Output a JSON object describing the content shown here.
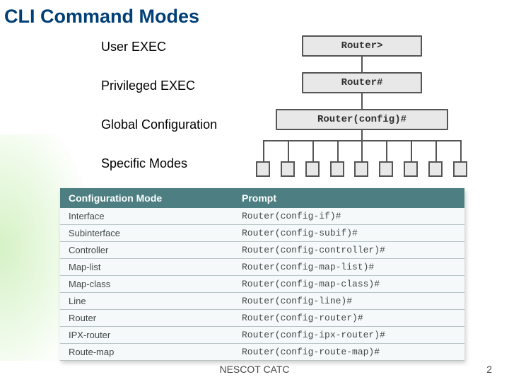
{
  "title": "CLI Command Modes",
  "modes": {
    "user_exec": "User EXEC",
    "priv_exec": "Privileged EXEC",
    "global_config": "Global Configuration",
    "specific": "Specific Modes"
  },
  "nodes": {
    "user_exec_prompt": "Router>",
    "priv_exec_prompt": "Router#",
    "global_config_prompt": "Router(config)#"
  },
  "table": {
    "headers": {
      "mode": "Configuration Mode",
      "prompt": "Prompt"
    },
    "rows": [
      {
        "mode": "Interface",
        "prompt": "Router(config-if)#"
      },
      {
        "mode": "Subinterface",
        "prompt": "Router(config-subif)#"
      },
      {
        "mode": "Controller",
        "prompt": "Router(config-controller)#"
      },
      {
        "mode": "Map-list",
        "prompt": "Router(config-map-list)#"
      },
      {
        "mode": "Map-class",
        "prompt": "Router(config-map-class)#"
      },
      {
        "mode": "Line",
        "prompt": "Router(config-line)#"
      },
      {
        "mode": "Router",
        "prompt": "Router(config-router)#"
      },
      {
        "mode": "IPX-router",
        "prompt": "Router(config-ipx-router)#"
      },
      {
        "mode": "Route-map",
        "prompt": "Router(config-route-map)#"
      }
    ]
  },
  "footer": "NESCOT CATC",
  "page_number": "2"
}
